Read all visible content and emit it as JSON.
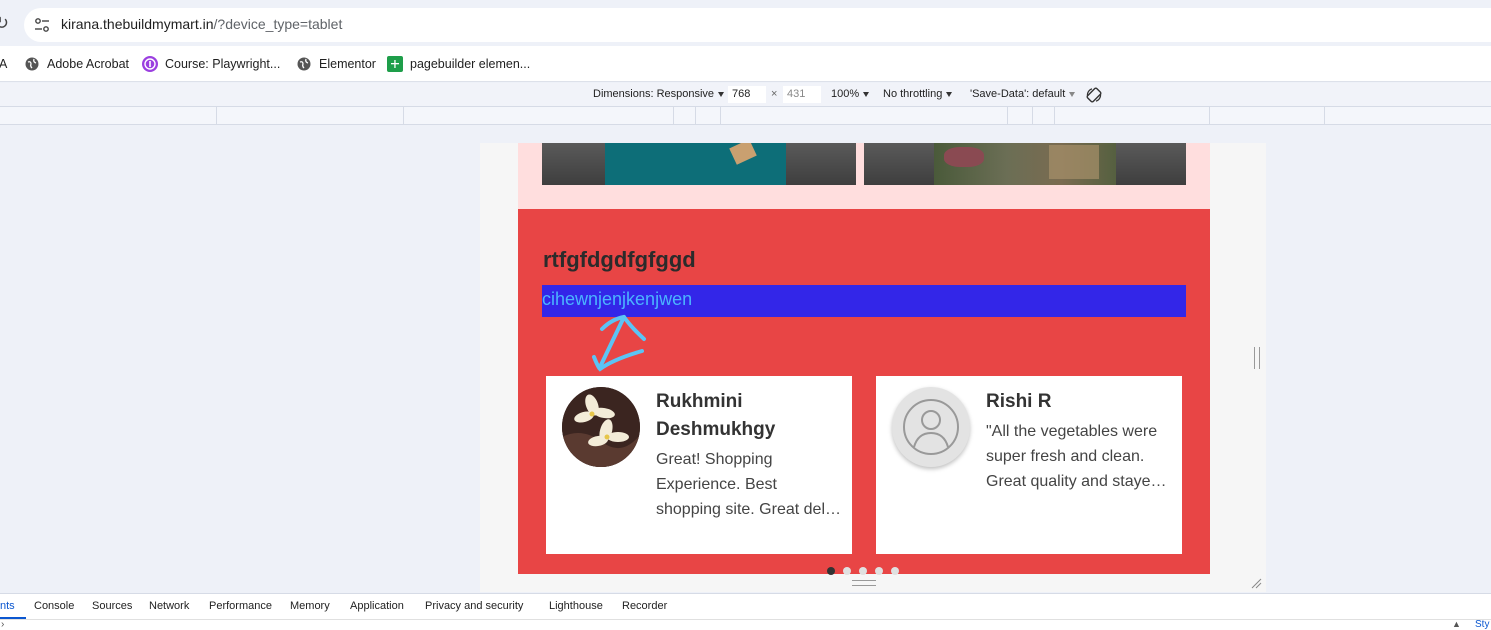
{
  "browser": {
    "url_host": "kirana.thebuildmymart.in",
    "url_rest": "/?device_type=tablet"
  },
  "bookmarks": [
    {
      "label": "A",
      "icon": "truncated-bookmark"
    },
    {
      "label": "Adobe Acrobat",
      "icon": "globe-icon"
    },
    {
      "label": "Course: Playwright...",
      "icon": "course-icon"
    },
    {
      "label": "Elementor",
      "icon": "globe-icon"
    },
    {
      "label": "pagebuilder elemen...",
      "icon": "sheets-icon"
    }
  ],
  "device_toolbar": {
    "dimensions": "Dimensions: Responsive",
    "width": "768",
    "times": "×",
    "height": "431",
    "zoom": "100%",
    "throttling": "No throttling",
    "save_data": "'Save-Data': default"
  },
  "page": {
    "section_title": "rtfgfdgdfgfggd",
    "highlight_text": "cihewnjenjkenjwen",
    "testimonials": [
      {
        "name_line1": "Rukhmini",
        "name_line2": "Deshmukhgy",
        "quote_lines": [
          "Great! Shopping",
          "Experience. Best",
          "shopping site. Great delivery."
        ],
        "avatar": "flower-photo"
      },
      {
        "name_line1": "Rishi R",
        "name_line2": "",
        "quote_lines": [
          "\"All the vegetables were",
          "super fresh and clean.",
          "Great quality and stayed fresh."
        ],
        "avatar": "user-placeholder-icon"
      }
    ],
    "carousel_dots": 5,
    "active_dot": 0
  },
  "devtools": {
    "tabs": [
      "nts",
      "Console",
      "Sources",
      "Network",
      "Performance",
      "Memory",
      "Application",
      "Privacy and security",
      "Lighthouse",
      "Recorder"
    ],
    "active_tab": "nts",
    "right_partial": "Sty"
  },
  "colors": {
    "red_section": "#e84545",
    "pink_strip": "#ffdede",
    "blue_bar": "#3326e8",
    "blue_text": "#4bb4ff",
    "annotation": "#5bc4f5"
  }
}
